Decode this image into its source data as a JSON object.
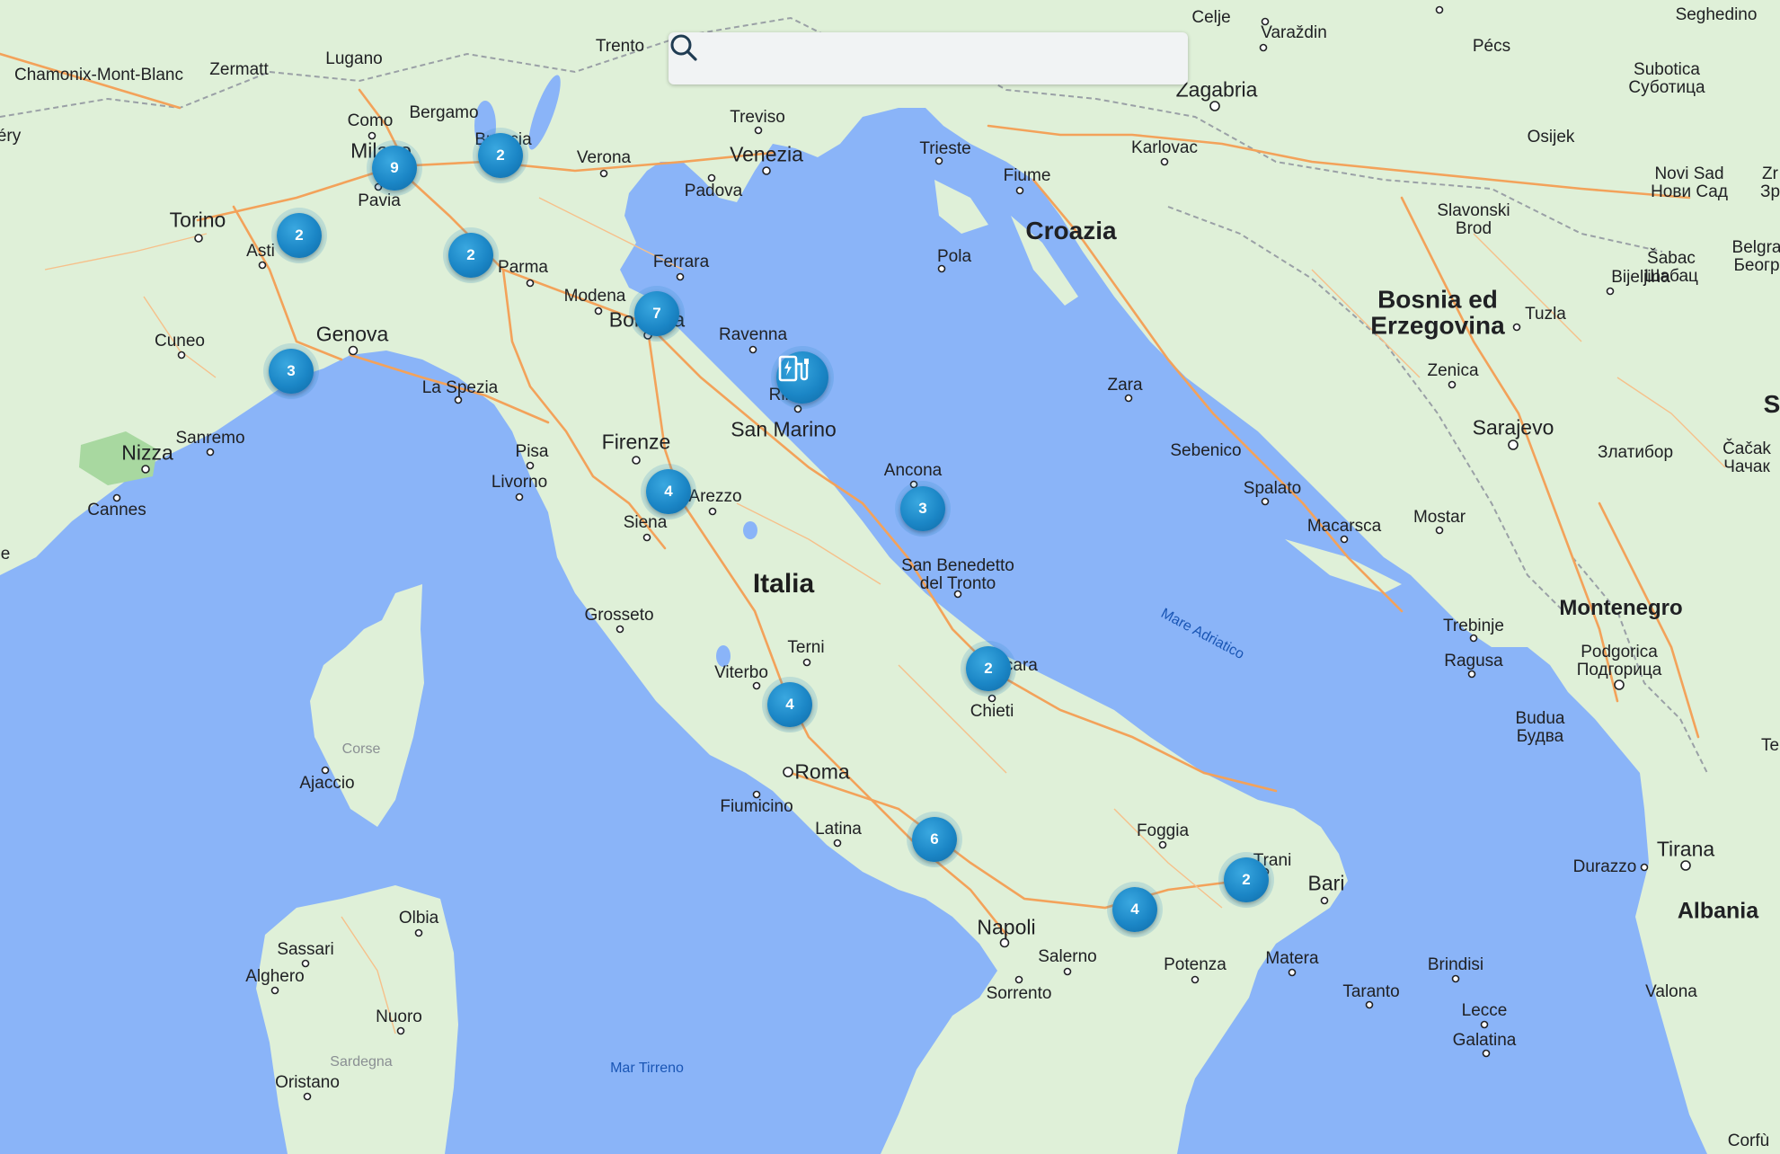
{
  "search": {
    "placeholder": "",
    "value": ""
  },
  "colors": {
    "water": "#8ab4f8",
    "land": "#dff0d8",
    "road": "#f3a25a",
    "border": "#9aa0a6",
    "marker": "#1b86c6"
  },
  "icons": {
    "search": "search-icon",
    "station": "ev-charging-station-icon"
  },
  "clusters": [
    {
      "count": "9"
    },
    {
      "count": "2"
    },
    {
      "count": "2"
    },
    {
      "count": "2"
    },
    {
      "count": "7"
    },
    {
      "count": "3"
    },
    {
      "count": "4"
    },
    {
      "count": "3"
    },
    {
      "count": "2"
    },
    {
      "count": "4"
    },
    {
      "count": "6"
    },
    {
      "count": "4"
    },
    {
      "count": "2"
    }
  ],
  "labels": {
    "celje": "Celje",
    "varazdin": "Varaždin",
    "pecs": "Pécs",
    "seghedino": "Seghedino",
    "trento": "Trento",
    "lugano": "Lugano",
    "zermatt": "Zermatt",
    "chamonix": "Chamonix-Mont-Blanc",
    "zagabria": "Zagabria",
    "subotica": "Subotica",
    "subotica_cyr": "Суботица",
    "treviso": "Treviso",
    "como": "Como",
    "bergamo": "Bergamo",
    "trieste": "Trieste",
    "venezia": "Venezia",
    "verona": "Verona",
    "brescia": "Brescia",
    "milano": "Milano",
    "karlovac": "Karlovac",
    "osijek": "Osijek",
    "padova": "Padova",
    "fiume": "Fiume",
    "novisad": "Novi Sad",
    "novisad_cyr": "Нови Сад",
    "torino": "Torino",
    "pavia": "Pavia",
    "slavonski": "Slavonski",
    "brod": "Brod",
    "croazia": "Croazia",
    "asti": "Asti",
    "parma": "Parma",
    "ferrara": "Ferrara",
    "pola": "Pola",
    "sabac": "Šabac",
    "sabac_cyr": "Шабац",
    "bijeljina": "Bijeljina",
    "belgrado": "Belgra",
    "beograd": "Беогр",
    "bosnia": "Bosnia ed",
    "erzegovina": "Erzegovina",
    "modena": "Modena",
    "bologna": "Bologna",
    "tuzla": "Tuzla",
    "cuneo": "Cuneo",
    "genova": "Genova",
    "ravenna": "Ravenna",
    "zenica": "Zenica",
    "laspezia": "La Spezia",
    "rimini": "Rimini",
    "zara": "Zara",
    "sanmarino": "San Marino",
    "sarajevo": "Sarajevo",
    "sanremo": "Sanremo",
    "nizza": "Nizza",
    "firenze": "Firenze",
    "sebenico": "Sebenico",
    "zlatibor": "Златибор",
    "cacak": "Čačak",
    "cacak_cyr": "Чачак",
    "pisa": "Pisa",
    "ancona": "Ancona",
    "livorno": "Livorno",
    "spalato": "Spalato",
    "cannes": "Cannes",
    "arezzo": "Arezzo",
    "macarsca": "Macarsca",
    "mostar": "Mostar",
    "siena": "Siena",
    "sanbenedetto1": "San Benedetto",
    "sanbenedetto2": "del Tronto",
    "italia": "Italia",
    "mareadriatico": "Mare Adriatico",
    "montenegro": "Montenegro",
    "grosseto": "Grosseto",
    "trebinje": "Trebinje",
    "terni": "Terni",
    "pescara": "Pescara",
    "ragusa": "Ragusa",
    "viterbo": "Viterbo",
    "podgorica": "Podgorica",
    "podgorica_cyr": "Подгорица",
    "chieti": "Chieti",
    "corse": "Corse",
    "budua": "Budua",
    "budua_cyr": "Будва",
    "ajaccio": "Ajaccio",
    "roma": "Roma",
    "fiumicino": "Fiumicino",
    "latina": "Latina",
    "foggia": "Foggia",
    "tirana": "Tirana",
    "trani": "Trani",
    "durazzo": "Durazzo",
    "bari": "Bari",
    "olbia": "Olbia",
    "albania": "Albania",
    "napoli": "Napoli",
    "sassari": "Sassari",
    "salerno": "Salerno",
    "matera": "Matera",
    "brindisi": "Brindisi",
    "alghero": "Alghero",
    "potenza": "Potenza",
    "sorrento": "Sorrento",
    "taranto": "Taranto",
    "valona": "Valona",
    "lecce": "Lecce",
    "nuoro": "Nuoro",
    "galatina": "Galatina",
    "sardegna": "Sardegna",
    "martirreno": "Mar Tirreno",
    "oristano": "Oristano",
    "corfu": "Corfù",
    "ery": "éry",
    "zr": "Zr",
    "zr_cyr": "Зр",
    "edge_s": "S",
    "edge_e": "e",
    "te": "Te"
  }
}
